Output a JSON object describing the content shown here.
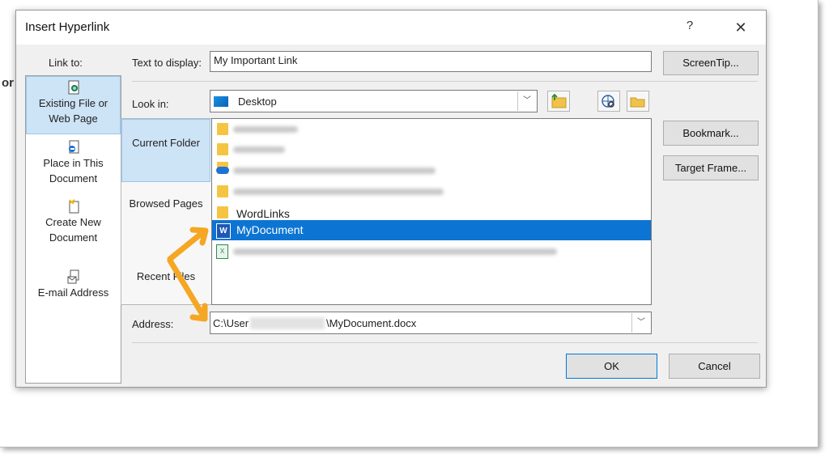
{
  "background_document": {
    "text_fragment": "or"
  },
  "dialog": {
    "title": "Insert Hyperlink",
    "help_label": "?",
    "close_label": "✕",
    "link_to_label": "Link to:",
    "text_to_display_label": "Text to display:",
    "text_to_display_value": "My Important Link",
    "screentip_button": "ScreenTip...",
    "link_to_items": [
      {
        "label": "Existing File or Web Page",
        "icon": "existing-file-icon",
        "selected": true
      },
      {
        "label": "Place in This Document",
        "icon": "place-in-document-icon",
        "selected": false
      },
      {
        "label": "Create New Document",
        "icon": "new-document-icon",
        "selected": false
      },
      {
        "label": "E-mail Address",
        "icon": "email-icon",
        "selected": false
      }
    ],
    "look_in_label": "Look in:",
    "look_in_value": "Desktop",
    "inner_nav": [
      {
        "label": "Current Folder",
        "selected": true
      },
      {
        "label": "Browsed Pages",
        "selected": false
      },
      {
        "label": "Recent Files",
        "selected": false
      }
    ],
    "files": [
      {
        "name": "",
        "type": "folder",
        "blurred": true
      },
      {
        "name": "",
        "type": "folder",
        "blurred": true
      },
      {
        "name": "",
        "type": "onedrive-folder",
        "blurred": true
      },
      {
        "name": "",
        "type": "folder",
        "blurred": true
      },
      {
        "name": "WordLinks",
        "type": "folder",
        "blurred": false
      },
      {
        "name": "MyDocument",
        "type": "word",
        "blurred": false,
        "selected": true
      },
      {
        "name": "",
        "type": "excel",
        "blurred": true
      }
    ],
    "bookmark_button": "Bookmark...",
    "target_frame_button": "Target Frame...",
    "address_label": "Address:",
    "address_prefix": "C:\\User",
    "address_suffix": "\\MyDocument.docx",
    "ok_button": "OK",
    "cancel_button": "Cancel",
    "colors": {
      "accent": "#0c74d3",
      "selection_bg": "#cde3f6",
      "arrow": "#f5a623"
    }
  }
}
